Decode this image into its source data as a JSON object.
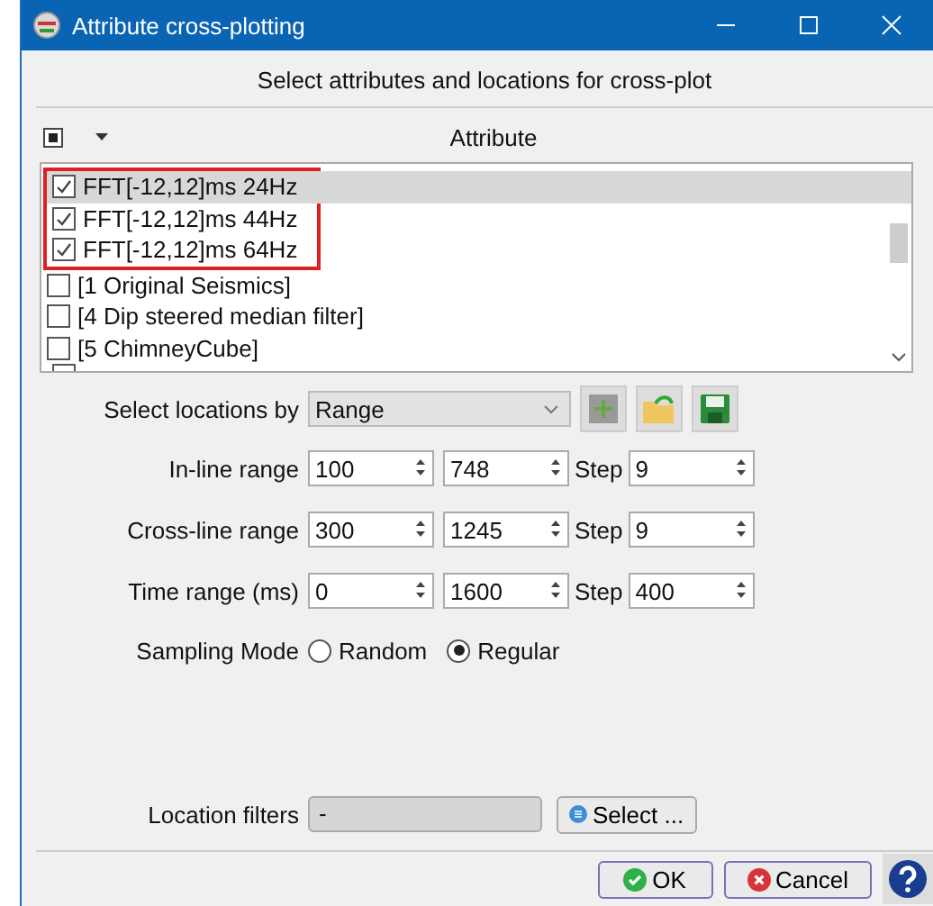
{
  "window": {
    "title": "Attribute cross-plotting"
  },
  "header": "Select attributes and locations for cross-plot",
  "attribute_header": {
    "select_all_checked": true,
    "label": "Attribute"
  },
  "attribute_list": {
    "highlighted_items": [
      {
        "label": "FFT[-12,12]ms 24Hz",
        "checked": true,
        "selected": true
      },
      {
        "label": "FFT[-12,12]ms 44Hz",
        "checked": true,
        "selected": false
      },
      {
        "label": "FFT[-12,12]ms 64Hz",
        "checked": true,
        "selected": false
      }
    ],
    "items": [
      {
        "label": "[1 Original Seismics]",
        "checked": false,
        "selected": false
      },
      {
        "label": "[4 Dip steered median filter]",
        "checked": false,
        "selected": false
      },
      {
        "label": "[5 ChimneyCube]",
        "checked": false,
        "selected": false
      }
    ]
  },
  "locations": {
    "label": "Select locations by",
    "value": "Range"
  },
  "ranges": [
    {
      "label": "In-line range",
      "from": "100",
      "to": "748",
      "step_label": "Step",
      "step": "9"
    },
    {
      "label": "Cross-line range",
      "from": "300",
      "to": "1245",
      "step_label": "Step",
      "step": "9"
    },
    {
      "label": "Time range (ms)",
      "from": "0",
      "to": "1600",
      "step_label": "Step",
      "step": "400"
    }
  ],
  "sampling": {
    "label": "Sampling Mode",
    "options": [
      {
        "label": "Random",
        "selected": false
      },
      {
        "label": "Regular",
        "selected": true
      }
    ]
  },
  "filters": {
    "label": "Location filters",
    "value": "-",
    "button": "Select ..."
  },
  "buttons": [
    {
      "kind": "ok",
      "label": "OK"
    },
    {
      "kind": "cancel",
      "label": "Cancel"
    }
  ]
}
